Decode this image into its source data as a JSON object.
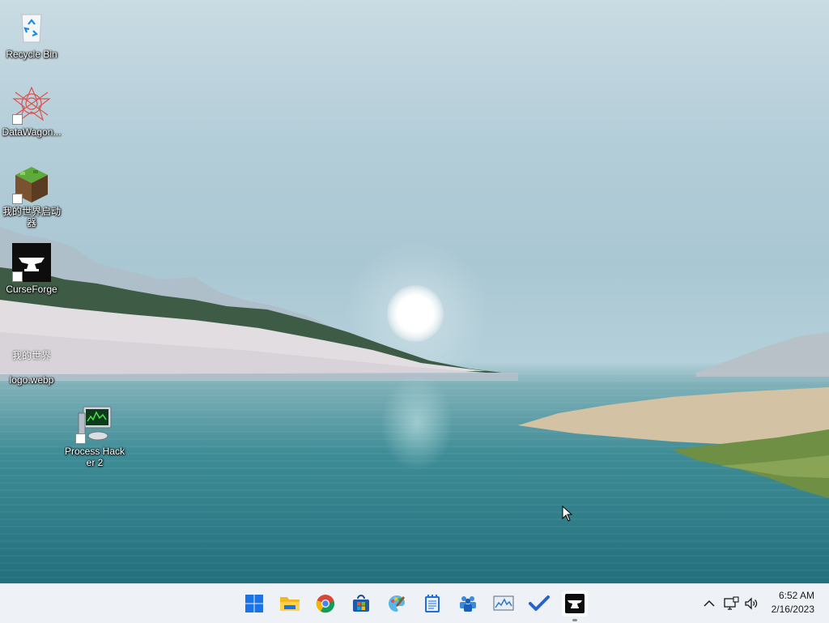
{
  "desktop": {
    "icons": [
      {
        "label": "Recycle Bin",
        "icon": "recycle-bin-icon"
      },
      {
        "label": "DataWagon...",
        "icon": "datawagon-icon"
      },
      {
        "label": "我的世界启动器",
        "icon": "minecraft-launcher-icon"
      },
      {
        "label": "CurseForge",
        "icon": "curseforge-icon"
      },
      {
        "label": "logo.webp",
        "icon": "image-file-icon",
        "thumbnail_text": "我的世界"
      },
      {
        "label": "Process Hacker 2",
        "icon": "process-hacker-icon"
      }
    ]
  },
  "taskbar": {
    "apps": [
      {
        "name": "Start",
        "icon": "windows-start-icon"
      },
      {
        "name": "File Explorer",
        "icon": "folder-icon"
      },
      {
        "name": "Google Chrome",
        "icon": "chrome-icon"
      },
      {
        "name": "Microsoft Store",
        "icon": "store-icon"
      },
      {
        "name": "Paint",
        "icon": "paint-icon"
      },
      {
        "name": "Notepad",
        "icon": "notepad-icon"
      },
      {
        "name": "Teams",
        "icon": "teams-icon"
      },
      {
        "name": "Resource Monitor",
        "icon": "monitor-chart-icon"
      },
      {
        "name": "To Do",
        "icon": "todo-check-icon"
      },
      {
        "name": "CurseForge",
        "icon": "curseforge-icon",
        "active": true
      }
    ],
    "tray": {
      "chevron": "chevron-up-icon",
      "network": "network-icon",
      "volume": "volume-icon"
    },
    "clock": {
      "time": "6:52 AM",
      "date": "2/16/2023"
    }
  },
  "colors": {
    "taskbar_bg": "#eef1f5",
    "win_blue": "#1a73e8",
    "curseforge_orange": "#f16436"
  }
}
